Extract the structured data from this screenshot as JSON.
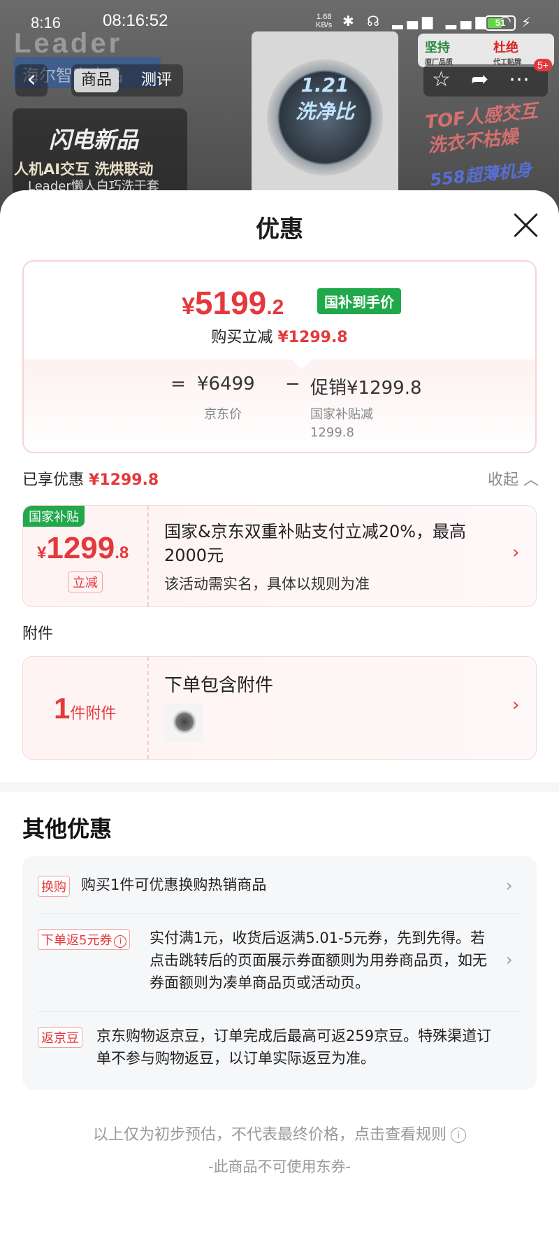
{
  "status_bar": {
    "time": "8:16",
    "clock": "08:16:52",
    "net_speed": "1.68",
    "net_unit": "KB/s",
    "battery": "51"
  },
  "background_page": {
    "brand_logo": "Leader",
    "brand_tag": "海尔智家出品",
    "promo_title": "闪电新品",
    "promo_line1": "人机AI交互 洗烘联动",
    "promo_line2": "Leader懒人白巧洗干套",
    "drum_text": "1.21\n洗净比",
    "slogan1": "TOF人感交互\n洗衣不枯燥",
    "slogan2": "558超薄机身",
    "guarantee1": "坚持",
    "guarantee1_sub": "原厂品质",
    "guarantee2": "杜绝",
    "guarantee2_sub": "代工贴牌"
  },
  "nav": {
    "back": "‹",
    "tab_product": "商品",
    "tab_review": "测评",
    "badge": "5+"
  },
  "sheet": {
    "title": "优惠",
    "price_card": {
      "currency": "¥",
      "final_int": "5199",
      "final_dec": ".2",
      "tag": "国补到手价",
      "instant_label": "购买立减",
      "instant_amount": "¥1299.8",
      "eq": "=",
      "jd_price": "¥6499",
      "minus": "−",
      "promo_label": "促销",
      "promo_amount": "¥1299.8",
      "jd_price_label": "京东价",
      "subsidy_label": "国家补贴减",
      "subsidy_amount": "1299.8"
    },
    "enjoyed_label": "已享优惠",
    "enjoyed_amount": "¥1299.8",
    "collapse_label": "收起",
    "coupon_subsidy": {
      "corner_tag": "国家补贴",
      "currency": "¥",
      "amount_int": "1299",
      "amount_dec": ".8",
      "reduce_label": "立减",
      "description": "国家&京东双重补贴支付立减20%，最高2000元",
      "note": "该活动需实名，具体以规则为准"
    },
    "accessory_section_label": "附件",
    "coupon_accessory": {
      "count": "1",
      "count_unit": "件附件",
      "title": "下单包含附件"
    },
    "other_title": "其他优惠",
    "offers": [
      {
        "tag": "换购",
        "text": "购买1件可优惠换购热销商品"
      },
      {
        "tag": "下单返5元券",
        "text": "实付满1元，收货后返满5.01-5元券，先到先得。若点击跳转后的页面展示券面额则为用券商品页，如无券面额则为凑单商品页或活动页。"
      },
      {
        "tag": "返京豆",
        "text": "京东购物返京豆，订单完成后最高可返259京豆。特殊渠道订单不参与购物返豆，以订单实际返豆为准。"
      }
    ],
    "footer_note": "以上仅为初步预估，不代表最终价格，点击查看规则",
    "footer_note2": "-此商品不可使用东券-"
  }
}
